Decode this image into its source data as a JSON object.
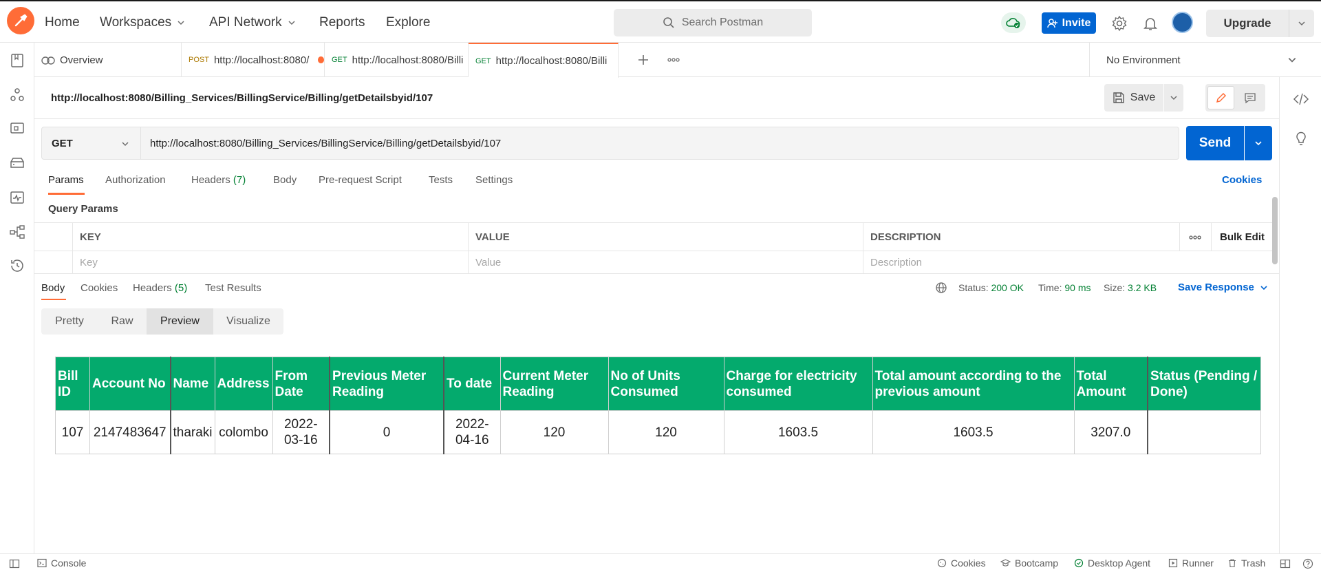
{
  "nav": {
    "home": "Home",
    "workspaces": "Workspaces",
    "api_network": "API Network",
    "reports": "Reports",
    "explore": "Explore"
  },
  "search": {
    "placeholder": "Search Postman"
  },
  "header_actions": {
    "invite": "Invite",
    "upgrade": "Upgrade"
  },
  "tabs": [
    {
      "label": "Overview",
      "icon": "overview-icon"
    },
    {
      "method": "POST",
      "label": "http://localhost:8080/",
      "unsaved": true
    },
    {
      "method": "GET",
      "label": "http://localhost:8080/Billi"
    },
    {
      "method": "GET",
      "label": "http://localhost:8080/Billi",
      "active": true
    }
  ],
  "environment": {
    "selected": "No Environment"
  },
  "request": {
    "title": "http://localhost:8080/Billing_Services/BillingService/Billing/getDetailsbyid/107",
    "save": "Save",
    "method": "GET",
    "url": "http://localhost:8080/Billing_Services/BillingService/Billing/getDetailsbyid/107",
    "send": "Send"
  },
  "request_tabs": {
    "params": "Params",
    "authorization": "Authorization",
    "headers": "Headers",
    "headers_count": "(7)",
    "body": "Body",
    "pre_request": "Pre-request Script",
    "tests": "Tests",
    "settings": "Settings",
    "cookies": "Cookies"
  },
  "query_params": {
    "label": "Query Params",
    "columns": {
      "key": "KEY",
      "value": "VALUE",
      "description": "DESCRIPTION"
    },
    "bulk_edit": "Bulk Edit",
    "placeholders": {
      "key": "Key",
      "value": "Value",
      "description": "Description"
    }
  },
  "response": {
    "tabs": {
      "body": "Body",
      "cookies": "Cookies",
      "headers": "Headers",
      "headers_count": "(5)",
      "test_results": "Test Results"
    },
    "status_label": "Status:",
    "status_value": "200 OK",
    "time_label": "Time:",
    "time_value": "90 ms",
    "size_label": "Size:",
    "size_value": "3.2 KB",
    "save_response": "Save Response",
    "views": [
      "Pretty",
      "Raw",
      "Preview",
      "Visualize"
    ],
    "active_view": "Preview"
  },
  "preview_table": {
    "headers": [
      "Bill ID",
      "Account No",
      "Name",
      "Address",
      "From Date",
      "Previous Meter Reading",
      "To date",
      "Current Meter Reading",
      "No of Units Consumed",
      "Charge for electricity consumed",
      "Total amount according to the previous amount",
      "Total Amount",
      "Status (Pending / Done)"
    ],
    "row": [
      "107",
      "2147483647",
      "tharaki",
      "colombo",
      "2022-03-16",
      "0",
      "2022-04-16",
      "120",
      "120",
      "1603.5",
      "1603.5",
      "3207.0",
      ""
    ],
    "header_color": "#04aa6d"
  },
  "statusbar": {
    "console": "Console",
    "cookies": "Cookies",
    "bootcamp": "Bootcamp",
    "desktop_agent": "Desktop Agent",
    "runner": "Runner",
    "trash": "Trash"
  },
  "colors": {
    "brand": "#ff6c37",
    "primary": "#0265d2",
    "success": "#007f31"
  }
}
